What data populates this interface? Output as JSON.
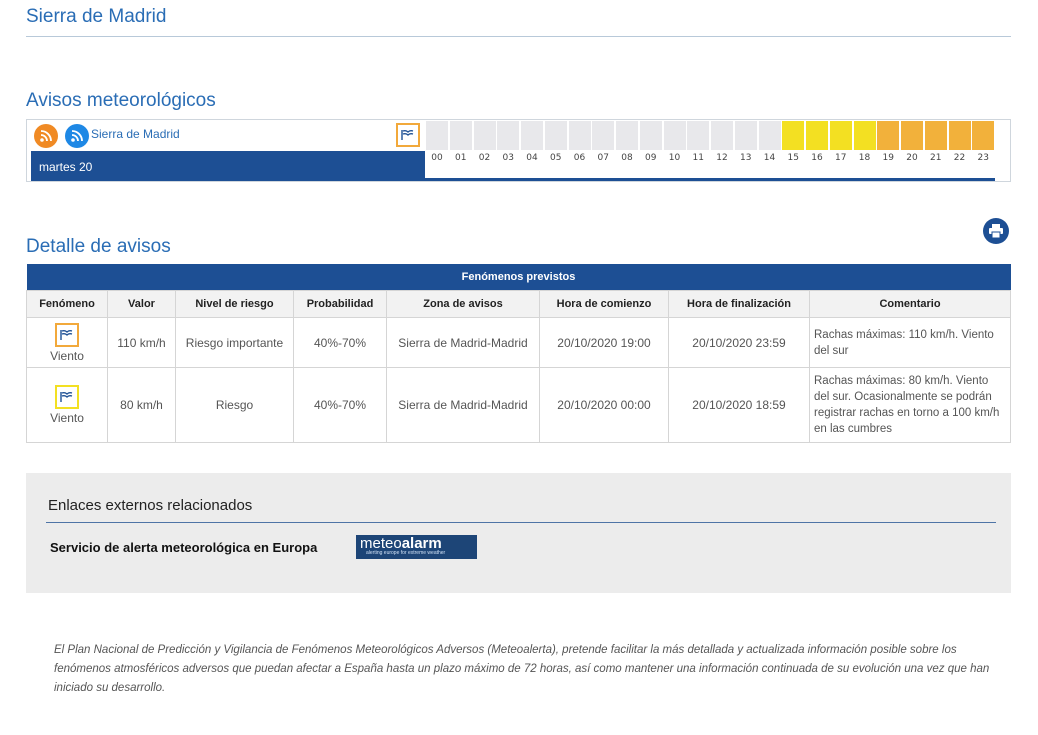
{
  "header": {
    "title": "Sierra de Madrid"
  },
  "avisos": {
    "title": "Avisos meteorológicos",
    "zone_link": "Sierra de Madrid",
    "day_label": "martes 20",
    "hours": [
      "00",
      "01",
      "02",
      "03",
      "04",
      "05",
      "06",
      "07",
      "08",
      "09",
      "10",
      "11",
      "12",
      "13",
      "14",
      "15",
      "16",
      "17",
      "18",
      "19",
      "20",
      "21",
      "22",
      "23"
    ],
    "hour_levels": [
      "none",
      "none",
      "none",
      "none",
      "none",
      "none",
      "none",
      "none",
      "none",
      "none",
      "none",
      "none",
      "none",
      "none",
      "none",
      "yellow",
      "yellow",
      "yellow",
      "yellow",
      "orange",
      "orange",
      "orange",
      "orange",
      "orange"
    ],
    "colors": {
      "none": "#e8e8eb",
      "yellow": "#f3e022",
      "orange": "#f2b13b"
    }
  },
  "detalle": {
    "title": "Detalle de avisos",
    "caption": "Fenómenos previstos",
    "columns": [
      "Fenómeno",
      "Valor",
      "Nivel de riesgo",
      "Probabilidad",
      "Zona de avisos",
      "Hora de comienzo",
      "Hora de finalización",
      "Comentario"
    ],
    "rows": [
      {
        "fenomeno": "Viento",
        "level_color": "orange",
        "valor": "110 km/h",
        "nivel": "Riesgo importante",
        "probabilidad": "40%-70%",
        "zona": "Sierra de Madrid-Madrid",
        "comienzo": "20/10/2020 19:00",
        "fin": "20/10/2020 23:59",
        "comentario": "Rachas máximas: 110 km/h. Viento del sur"
      },
      {
        "fenomeno": "Viento",
        "level_color": "yellow",
        "valor": "80 km/h",
        "nivel": "Riesgo",
        "probabilidad": "40%-70%",
        "zona": "Sierra de Madrid-Madrid",
        "comienzo": "20/10/2020 00:00",
        "fin": "20/10/2020 18:59",
        "comentario": "Rachas máximas: 80 km/h. Viento del sur. Ocasionalmente se podrán registrar rachas en torno a 100 km/h en las cumbres"
      }
    ]
  },
  "enlaces": {
    "title": "Enlaces externos relacionados",
    "link_label": "Servicio de alerta meteorológica en Europa",
    "logo_text_main": "meteo",
    "logo_text_bold": "alarm",
    "logo_subtitle": "alerting europe for extreme weather"
  },
  "footer": {
    "text": "El Plan Nacional de Predicción y Vigilancia de Fenómenos Meteorológicos Adversos (Meteoalerta), pretende facilitar la más detallada y actualizada información posible sobre los fenómenos atmosféricos adversos que puedan afectar a España hasta un plazo máximo de 72 horas, así como mantener una información continuada de su evolución una vez que han iniciado su desarrollo."
  },
  "icons": {
    "rss_orange": "rss-icon",
    "rss_blue": "rss-icon",
    "wind": "wind-warning-icon",
    "print": "print-icon"
  }
}
